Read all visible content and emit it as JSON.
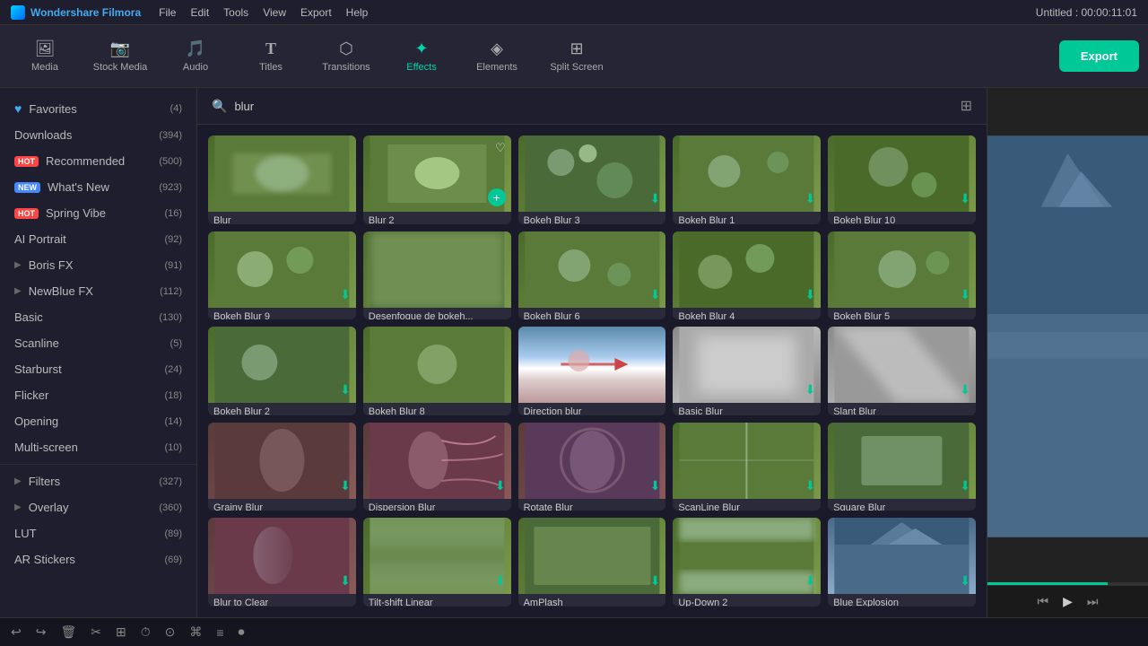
{
  "app": {
    "title": "Wondershare Filmora",
    "window_time": "Untitled : 00:00:11:01"
  },
  "menu": {
    "items": [
      "File",
      "Edit",
      "Tools",
      "View",
      "Export",
      "Help"
    ]
  },
  "nav": {
    "items": [
      {
        "id": "media",
        "label": "Media",
        "icon": "🖼"
      },
      {
        "id": "stock",
        "label": "Stock Media",
        "icon": "📷"
      },
      {
        "id": "audio",
        "label": "Audio",
        "icon": "🎵"
      },
      {
        "id": "titles",
        "label": "Titles",
        "icon": "T"
      },
      {
        "id": "transitions",
        "label": "Transitions",
        "icon": "⟷"
      },
      {
        "id": "effects",
        "label": "Effects",
        "icon": "✦",
        "active": true
      },
      {
        "id": "elements",
        "label": "Elements",
        "icon": "⬡"
      },
      {
        "id": "split",
        "label": "Split Screen",
        "icon": "⊞"
      }
    ],
    "export_label": "Export"
  },
  "sidebar": {
    "items": [
      {
        "id": "favorites",
        "label": "Favorites",
        "count": 4,
        "icon": "♡",
        "is_fav": true
      },
      {
        "id": "downloads",
        "label": "Downloads",
        "count": 394
      },
      {
        "id": "recommended",
        "label": "Recommended",
        "count": 500,
        "badge": "HOT"
      },
      {
        "id": "whats_new",
        "label": "What's New",
        "count": 923,
        "badge": "NEW"
      },
      {
        "id": "spring_vibe",
        "label": "Spring Vibe",
        "count": 16,
        "badge": "HOT"
      },
      {
        "id": "ai_portrait",
        "label": "AI Portrait",
        "count": 92
      },
      {
        "id": "boris_fx",
        "label": "Boris FX",
        "count": 91,
        "has_arrow": true
      },
      {
        "id": "newblue_fx",
        "label": "NewBlue FX",
        "count": 112,
        "has_arrow": true
      },
      {
        "id": "basic",
        "label": "Basic",
        "count": 130
      },
      {
        "id": "scanline",
        "label": "Scanline",
        "count": 5
      },
      {
        "id": "starburst",
        "label": "Starburst",
        "count": 24
      },
      {
        "id": "flicker",
        "label": "Flicker",
        "count": 18
      },
      {
        "id": "opening",
        "label": "Opening",
        "count": 14
      },
      {
        "id": "multi_screen",
        "label": "Multi-screen",
        "count": 10
      },
      {
        "id": "filters",
        "label": "Filters",
        "count": 327,
        "has_arrow": true
      },
      {
        "id": "overlay",
        "label": "Overlay",
        "count": 360,
        "has_arrow": true
      },
      {
        "id": "lut",
        "label": "LUT",
        "count": 89
      },
      {
        "id": "ar_stickers",
        "label": "AR Stickers",
        "count": 69
      }
    ]
  },
  "search": {
    "placeholder": "blur",
    "value": "blur"
  },
  "effects": {
    "items": [
      {
        "id": "blur",
        "name": "Blur",
        "thumb_class": "thumb-field",
        "has_dl": false,
        "has_add": false
      },
      {
        "id": "blur2",
        "name": "Blur 2",
        "thumb_class": "thumb-field",
        "has_dl": false,
        "has_add": true,
        "has_heart": true
      },
      {
        "id": "bokeh3",
        "name": "Bokeh Blur 3",
        "thumb_class": "thumb-field",
        "has_dl": true
      },
      {
        "id": "bokeh1",
        "name": "Bokeh Blur 1",
        "thumb_class": "thumb-field",
        "has_dl": true
      },
      {
        "id": "bokeh10",
        "name": "Bokeh Blur 10",
        "thumb_class": "thumb-field",
        "has_dl": true
      },
      {
        "id": "bokeh9",
        "name": "Bokeh Blur 9",
        "thumb_class": "thumb-field",
        "has_dl": true
      },
      {
        "id": "desenfoque",
        "name": "Desenfoque de bokeh...",
        "thumb_class": "thumb-field",
        "has_dl": false
      },
      {
        "id": "bokeh6",
        "name": "Bokeh Blur 6",
        "thumb_class": "thumb-field",
        "has_dl": true
      },
      {
        "id": "bokeh4",
        "name": "Bokeh Blur 4",
        "thumb_class": "thumb-field",
        "has_dl": true
      },
      {
        "id": "bokeh5",
        "name": "Bokeh Blur 5",
        "thumb_class": "thumb-field",
        "has_dl": true
      },
      {
        "id": "bokeh2",
        "name": "Bokeh Blur 2",
        "thumb_class": "thumb-field",
        "has_dl": true
      },
      {
        "id": "bokeh8",
        "name": "Bokeh Blur 8",
        "thumb_class": "thumb-field",
        "has_dl": false
      },
      {
        "id": "direction",
        "name": "Direction blur",
        "thumb_class": "thumb-sky",
        "has_dl": false
      },
      {
        "id": "basic_blur",
        "name": "Basic Blur",
        "thumb_class": "thumb-blur",
        "has_dl": true
      },
      {
        "id": "slant",
        "name": "Slant Blur",
        "thumb_class": "thumb-blur",
        "has_dl": true
      },
      {
        "id": "grainy",
        "name": "Grainy Blur",
        "thumb_class": "thumb-portrait",
        "has_dl": true
      },
      {
        "id": "dispersion",
        "name": "Dispersion Blur",
        "thumb_class": "thumb-portrait",
        "has_dl": true
      },
      {
        "id": "rotate",
        "name": "Rotate Blur",
        "thumb_class": "thumb-portrait",
        "has_dl": true
      },
      {
        "id": "scanline_blur",
        "name": "ScanLine Blur",
        "thumb_class": "thumb-field",
        "has_dl": true
      },
      {
        "id": "square",
        "name": "Square Blur",
        "thumb_class": "thumb-field",
        "has_dl": true
      },
      {
        "id": "blur_clear",
        "name": "Blur to Clear",
        "thumb_class": "thumb-portrait",
        "has_dl": true
      },
      {
        "id": "tiltshift",
        "name": "Tilt-shift Linear",
        "thumb_class": "thumb-field",
        "has_dl": true
      },
      {
        "id": "amplash",
        "name": "AmPlash",
        "thumb_class": "thumb-field",
        "has_dl": true
      },
      {
        "id": "updown2",
        "name": "Up-Down 2",
        "thumb_class": "thumb-field",
        "has_dl": true
      },
      {
        "id": "blue_explosion",
        "name": "Blue Explosion",
        "thumb_class": "thumb-mountain",
        "has_dl": true
      }
    ]
  },
  "preview": {
    "progress": 75
  },
  "bottom_tools": [
    "↩",
    "↪",
    "🗑",
    "✂",
    "⊞",
    "⏱",
    "☉",
    "⌘",
    "≡",
    "▶"
  ]
}
